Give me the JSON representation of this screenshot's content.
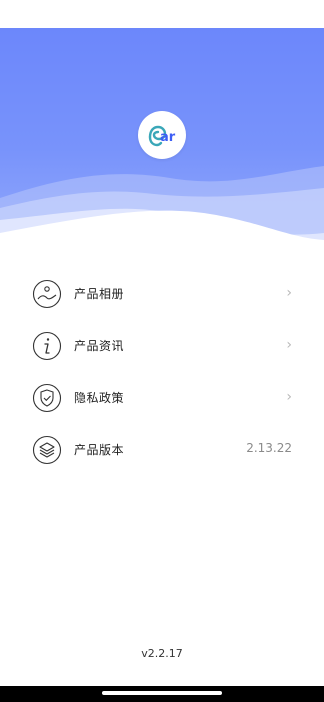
{
  "app": {
    "logo_text": "ear"
  },
  "menu": {
    "items": [
      {
        "label": "产品相册",
        "icon": "album-icon",
        "chevron": "›"
      },
      {
        "label": "产品资讯",
        "icon": "info-icon",
        "chevron": "›"
      },
      {
        "label": "隐私政策",
        "icon": "shield-check-icon",
        "chevron": "›"
      },
      {
        "label": "产品版本",
        "icon": "layers-icon",
        "value": "2.13.22"
      }
    ]
  },
  "footer": {
    "version": "v2.2.17"
  },
  "colors": {
    "header_gradient_top": "#6c87fb",
    "header_gradient_bottom": "#93a9fb",
    "logo_primary": "#3aa7b8",
    "logo_accent": "#3d5ef5"
  }
}
